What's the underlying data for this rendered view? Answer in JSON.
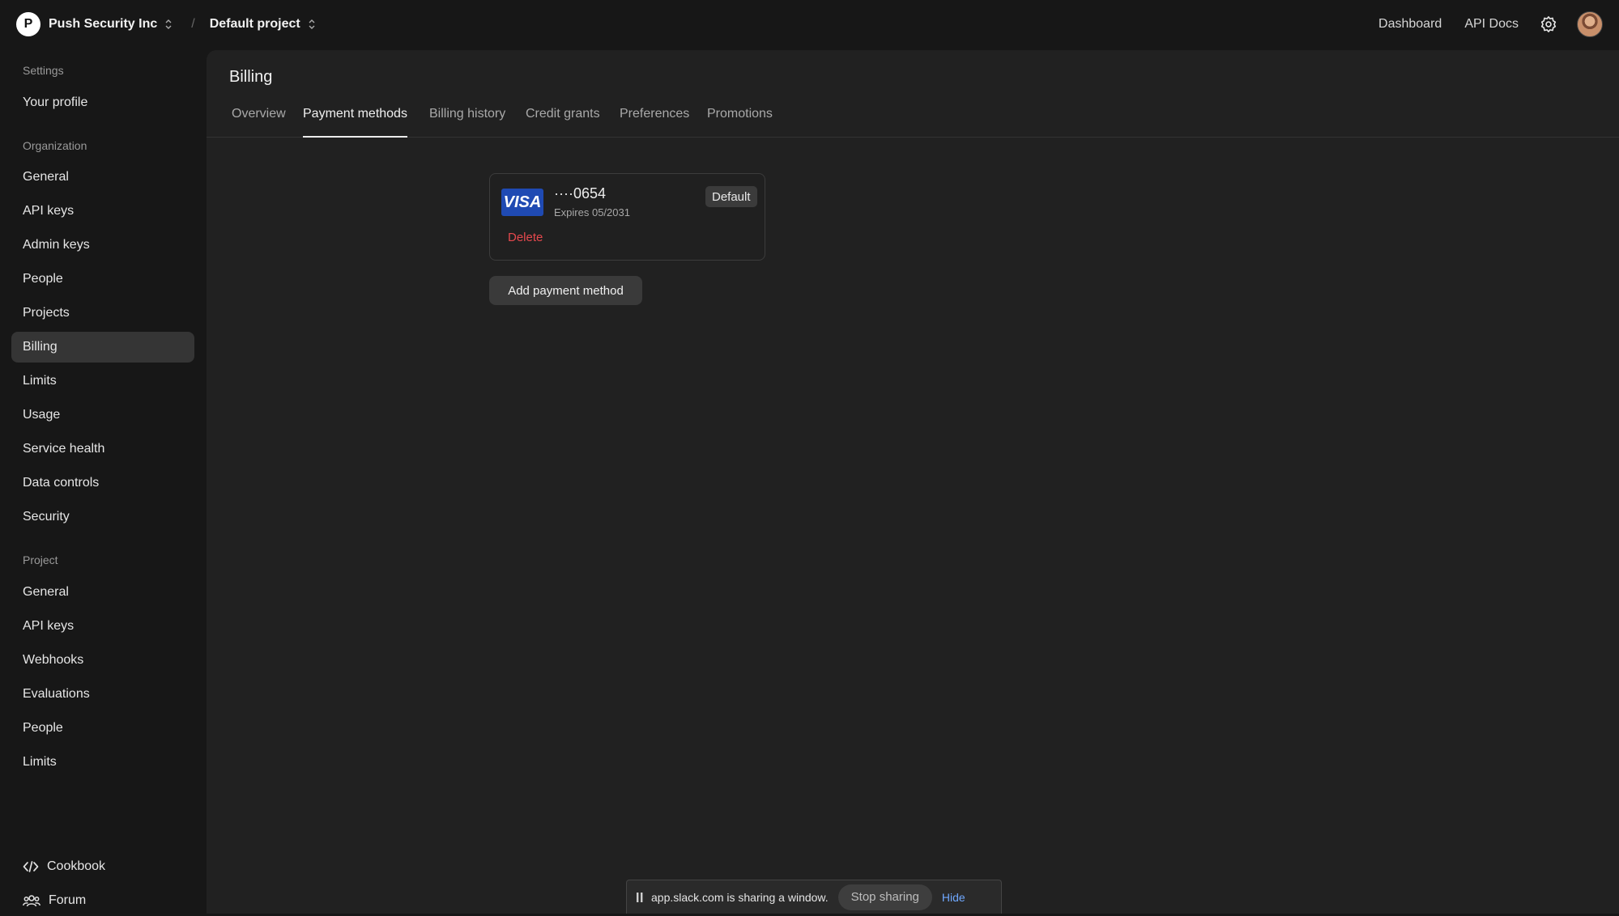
{
  "topbar": {
    "org_initial": "P",
    "org_name": "Push Security Inc",
    "separator": "/",
    "project_name": "Default project",
    "links": [
      "Dashboard",
      "API Docs"
    ]
  },
  "sidebar": {
    "settings_label": "Settings",
    "your_profile": "Your profile",
    "organization_label": "Organization",
    "org_items": [
      "General",
      "API keys",
      "Admin keys",
      "People",
      "Projects",
      "Billing",
      "Limits",
      "Usage",
      "Service health",
      "Data controls",
      "Security"
    ],
    "project_label": "Project",
    "project_items": [
      "General",
      "API keys",
      "Webhooks",
      "Evaluations",
      "People",
      "Limits"
    ],
    "footer_items": [
      "Cookbook",
      "Forum"
    ]
  },
  "main": {
    "title": "Billing",
    "tabs": [
      "Overview",
      "Payment methods",
      "Billing history",
      "Credit grants",
      "Preferences",
      "Promotions"
    ],
    "active_tab": "Payment methods"
  },
  "card": {
    "brand": "VISA",
    "number": "····0654",
    "expires": "Expires 05/2031",
    "badge": "Default",
    "delete_label": "Delete"
  },
  "add_button": "Add payment method",
  "share_bar": {
    "text": "app.slack.com is sharing a window.",
    "stop_label": "Stop sharing",
    "hide_label": "Hide"
  },
  "colors": {
    "background": "#171717",
    "panel": "#212121",
    "active_item": "#353535",
    "danger": "#e5484d",
    "visa_blue": "#1f4ab3",
    "link_blue": "#6fa8ff"
  }
}
